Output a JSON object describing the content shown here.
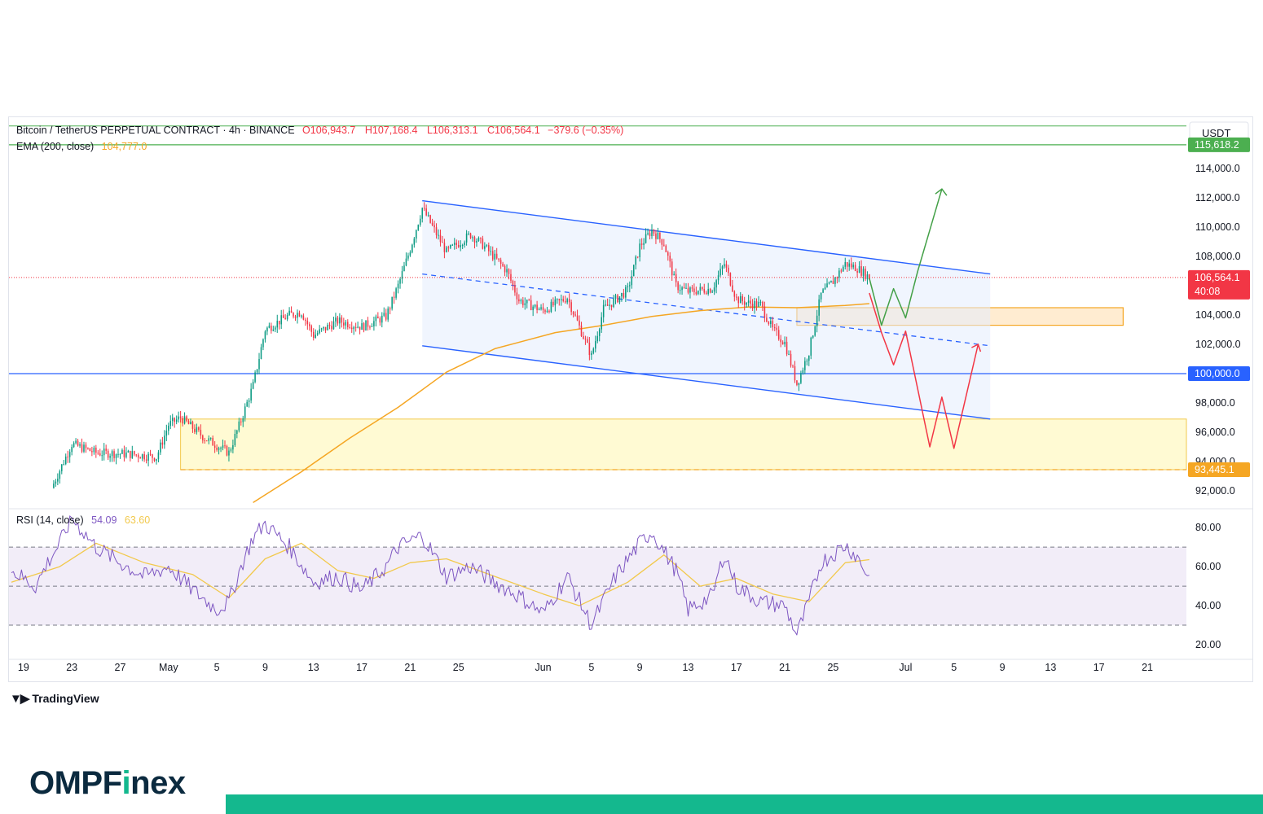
{
  "header": {
    "symbol": "Bitcoin / TetherUS PERPETUAL CONTRACT · 4h · BINANCE",
    "open": "O106,943.7",
    "high": "H107,168.4",
    "low": "L106,313.1",
    "close": "C106,564.1",
    "change": "−379.6 (−0.35%)",
    "ema_label": "EMA (200, close)",
    "ema_value": "104,777.0",
    "currency": "USDT",
    "rsi_label": "RSI (14, close)",
    "rsi_value": "54.09",
    "rsi_ma_value": "63.60"
  },
  "tags": {
    "resistance": "115,618.2",
    "current_price": "106,564.1",
    "countdown": "40:08",
    "support_round": "100,000.0",
    "support_zone": "93,445.1"
  },
  "colors": {
    "up": "#089981",
    "down": "#f23645",
    "ema": "#f5a623",
    "channel": "#2962ff",
    "green_line": "#4caf50",
    "rsi": "#7e57c2",
    "rsi_ma": "#f2c94c",
    "brand_green": "#14b88e"
  },
  "brand": {
    "name_part1": "OMPF",
    "name_i": "i",
    "name_part2": "nex",
    "tradingview": "TradingView"
  },
  "chart_data": [
    {
      "type": "candlestick",
      "title": "Bitcoin / TetherUS PERPETUAL CONTRACT · 4h · BINANCE",
      "ylim": [
        91000,
        117500
      ],
      "y_ticks": [
        "92,000.0",
        "94,000.0",
        "96,000.0",
        "98,000.0",
        "102,000.0",
        "104,000.0",
        "108,000.0",
        "110,000.0",
        "112,000.0",
        "114,000.0",
        "116,000.0"
      ],
      "x_ticks": [
        "19",
        "23",
        "27",
        "May",
        "5",
        "9",
        "13",
        "17",
        "21",
        "25",
        "Jun",
        "5",
        "9",
        "13",
        "17",
        "21",
        "25",
        "Jul",
        "5",
        "9",
        "13",
        "17",
        "21"
      ],
      "x_range_days": [
        "2025-04-18",
        "2025-07-24"
      ],
      "price_path": [
        [
          "2025-04-22",
          93400
        ],
        [
          "2025-04-23",
          95200
        ],
        [
          "2025-04-25",
          94600
        ],
        [
          "2025-04-28",
          94500
        ],
        [
          "2025-04-30",
          94300
        ],
        [
          "2025-05-01",
          96500
        ],
        [
          "2025-05-02",
          97000
        ],
        [
          "2025-05-04",
          95600
        ],
        [
          "2025-05-06",
          94600
        ],
        [
          "2025-05-07",
          96800
        ],
        [
          "2025-05-08",
          99200
        ],
        [
          "2025-05-09",
          103000
        ],
        [
          "2025-05-11",
          104000
        ],
        [
          "2025-05-12",
          104200
        ],
        [
          "2025-05-13",
          102600
        ],
        [
          "2025-05-15",
          103600
        ],
        [
          "2025-05-17",
          103200
        ],
        [
          "2025-05-19",
          103900
        ],
        [
          "2025-05-20",
          106000
        ],
        [
          "2025-05-21",
          108500
        ],
        [
          "2025-05-22",
          111300
        ],
        [
          "2025-05-23",
          109800
        ],
        [
          "2025-05-24",
          108300
        ],
        [
          "2025-05-26",
          109500
        ],
        [
          "2025-05-27",
          108800
        ],
        [
          "2025-05-29",
          107000
        ],
        [
          "2025-05-30",
          105000
        ],
        [
          "2025-06-01",
          104300
        ],
        [
          "2025-06-03",
          105200
        ],
        [
          "2025-06-05",
          101200
        ],
        [
          "2025-06-06",
          104400
        ],
        [
          "2025-06-08",
          105700
        ],
        [
          "2025-06-09",
          108700
        ],
        [
          "2025-06-10",
          109800
        ],
        [
          "2025-06-11",
          108900
        ],
        [
          "2025-06-12",
          106000
        ],
        [
          "2025-06-13",
          105600
        ],
        [
          "2025-06-15",
          105800
        ],
        [
          "2025-06-16",
          107500
        ],
        [
          "2025-06-17",
          105100
        ],
        [
          "2025-06-18",
          104800
        ],
        [
          "2025-06-19",
          104700
        ],
        [
          "2025-06-20",
          103000
        ],
        [
          "2025-06-21",
          102100
        ],
        [
          "2025-06-22",
          99300
        ],
        [
          "2025-06-23",
          101500
        ],
        [
          "2025-06-24",
          105400
        ],
        [
          "2025-06-25",
          106300
        ],
        [
          "2025-06-26",
          107500
        ],
        [
          "2025-06-27",
          107200
        ],
        [
          "2025-06-28",
          106564
        ]
      ],
      "ema200": [
        [
          "2025-05-08",
          91200
        ],
        [
          "2025-05-12",
          93300
        ],
        [
          "2025-05-16",
          95600
        ],
        [
          "2025-05-20",
          97700
        ],
        [
          "2025-05-24",
          100100
        ],
        [
          "2025-05-28",
          101700
        ],
        [
          "2025-06-02",
          102800
        ],
        [
          "2025-06-06",
          103300
        ],
        [
          "2025-06-10",
          103900
        ],
        [
          "2025-06-14",
          104300
        ],
        [
          "2025-06-18",
          104550
        ],
        [
          "2025-06-22",
          104500
        ],
        [
          "2025-06-26",
          104650
        ],
        [
          "2025-06-28",
          104777
        ]
      ],
      "channel_upper": [
        [
          "2025-05-22",
          111800
        ],
        [
          "2025-07-08",
          106800
        ]
      ],
      "channel_mid": [
        [
          "2025-05-22",
          106800
        ],
        [
          "2025-07-08",
          101900
        ]
      ],
      "channel_lower": [
        [
          "2025-05-22",
          101900
        ],
        [
          "2025-07-08",
          96900
        ]
      ],
      "horizontal_levels": [
        115618.2,
        100000,
        93445.1
      ],
      "top_line": 116900,
      "support_zone": [
        93445.1,
        96900
      ],
      "resistance_zone": [
        103300,
        104500
      ],
      "bull_projection": [
        [
          "2025-06-28",
          106500
        ],
        [
          "2025-06-29",
          103300
        ],
        [
          "2025-06-30",
          105800
        ],
        [
          "2025-07-01",
          103800
        ],
        [
          "2025-07-02",
          107000
        ],
        [
          "2025-07-04",
          112600
        ]
      ],
      "bear_projection": [
        [
          "2025-06-28",
          105500
        ],
        [
          "2025-06-29",
          102800
        ],
        [
          "2025-06-30",
          100600
        ],
        [
          "2025-07-01",
          102900
        ],
        [
          "2025-07-03",
          95000
        ],
        [
          "2025-07-04",
          98400
        ],
        [
          "2025-07-05",
          94900
        ],
        [
          "2025-07-07",
          102000
        ]
      ]
    },
    {
      "type": "line",
      "title": "RSI (14, close)",
      "ylim": [
        15,
        88
      ],
      "y_ticks": [
        "20.00",
        "40.00",
        "60.00",
        "80.00"
      ],
      "levels": [
        70,
        50,
        30
      ],
      "rsi": [
        [
          "2025-04-18",
          58
        ],
        [
          "2025-04-20",
          50
        ],
        [
          "2025-04-21",
          62
        ],
        [
          "2025-04-22",
          72
        ],
        [
          "2025-04-23",
          85
        ],
        [
          "2025-04-25",
          70
        ],
        [
          "2025-04-27",
          62
        ],
        [
          "2025-04-29",
          55
        ],
        [
          "2025-05-01",
          60
        ],
        [
          "2025-05-03",
          48
        ],
        [
          "2025-05-05",
          38
        ],
        [
          "2025-05-06",
          42
        ],
        [
          "2025-05-07",
          60
        ],
        [
          "2025-05-08",
          75
        ],
        [
          "2025-05-09",
          82
        ],
        [
          "2025-05-11",
          70
        ],
        [
          "2025-05-13",
          52
        ],
        [
          "2025-05-15",
          55
        ],
        [
          "2025-05-17",
          48
        ],
        [
          "2025-05-19",
          60
        ],
        [
          "2025-05-20",
          70
        ],
        [
          "2025-05-22",
          76
        ],
        [
          "2025-05-24",
          55
        ],
        [
          "2025-05-26",
          60
        ],
        [
          "2025-05-28",
          52
        ],
        [
          "2025-05-30",
          45
        ],
        [
          "2025-06-01",
          36
        ],
        [
          "2025-06-03",
          55
        ],
        [
          "2025-06-05",
          30
        ],
        [
          "2025-06-07",
          55
        ],
        [
          "2025-06-09",
          72
        ],
        [
          "2025-06-10",
          78
        ],
        [
          "2025-06-12",
          58
        ],
        [
          "2025-06-13",
          38
        ],
        [
          "2025-06-15",
          45
        ],
        [
          "2025-06-16",
          67
        ],
        [
          "2025-06-17",
          50
        ],
        [
          "2025-06-19",
          42
        ],
        [
          "2025-06-21",
          40
        ],
        [
          "2025-06-22",
          25
        ],
        [
          "2025-06-23",
          42
        ],
        [
          "2025-06-24",
          62
        ],
        [
          "2025-06-26",
          71
        ],
        [
          "2025-06-27",
          65
        ],
        [
          "2025-06-28",
          54.09
        ]
      ],
      "rsi_ma": [
        [
          "2025-04-18",
          52
        ],
        [
          "2025-04-22",
          60
        ],
        [
          "2025-04-25",
          72
        ],
        [
          "2025-04-29",
          62
        ],
        [
          "2025-05-03",
          56
        ],
        [
          "2025-05-06",
          44
        ],
        [
          "2025-05-09",
          64
        ],
        [
          "2025-05-12",
          72
        ],
        [
          "2025-05-15",
          58
        ],
        [
          "2025-05-18",
          54
        ],
        [
          "2025-05-21",
          62
        ],
        [
          "2025-05-24",
          64
        ],
        [
          "2025-05-28",
          55
        ],
        [
          "2025-06-01",
          46
        ],
        [
          "2025-06-04",
          40
        ],
        [
          "2025-06-08",
          52
        ],
        [
          "2025-06-11",
          66
        ],
        [
          "2025-06-14",
          50
        ],
        [
          "2025-06-17",
          54
        ],
        [
          "2025-06-20",
          46
        ],
        [
          "2025-06-23",
          42
        ],
        [
          "2025-06-26",
          62
        ],
        [
          "2025-06-28",
          63.6
        ]
      ]
    }
  ]
}
